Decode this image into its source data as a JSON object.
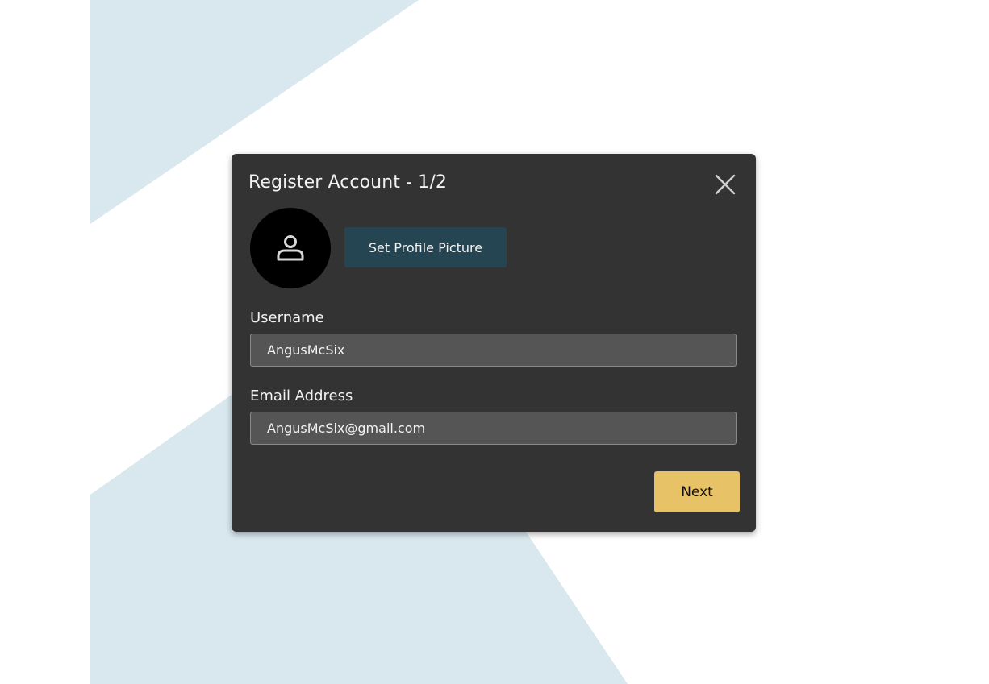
{
  "colors": {
    "background": "#ffffff",
    "decor_shape": "#d9e8ef",
    "dialog_bg": "#333333",
    "input_bg": "#555555",
    "secondary_button": "#264553",
    "primary_button": "#e8c266",
    "text": "#f2f2f2"
  },
  "dialog": {
    "title": "Register Account - 1/2",
    "close_icon": "close-icon",
    "avatar_icon": "user-icon",
    "set_picture_label": "Set Profile Picture",
    "fields": {
      "username": {
        "label": "Username",
        "value": "AngusMcSix",
        "placeholder": ""
      },
      "email": {
        "label": "Email Address",
        "value": "AngusMcSix@gmail.com",
        "placeholder": ""
      }
    },
    "next_label": "Next"
  }
}
